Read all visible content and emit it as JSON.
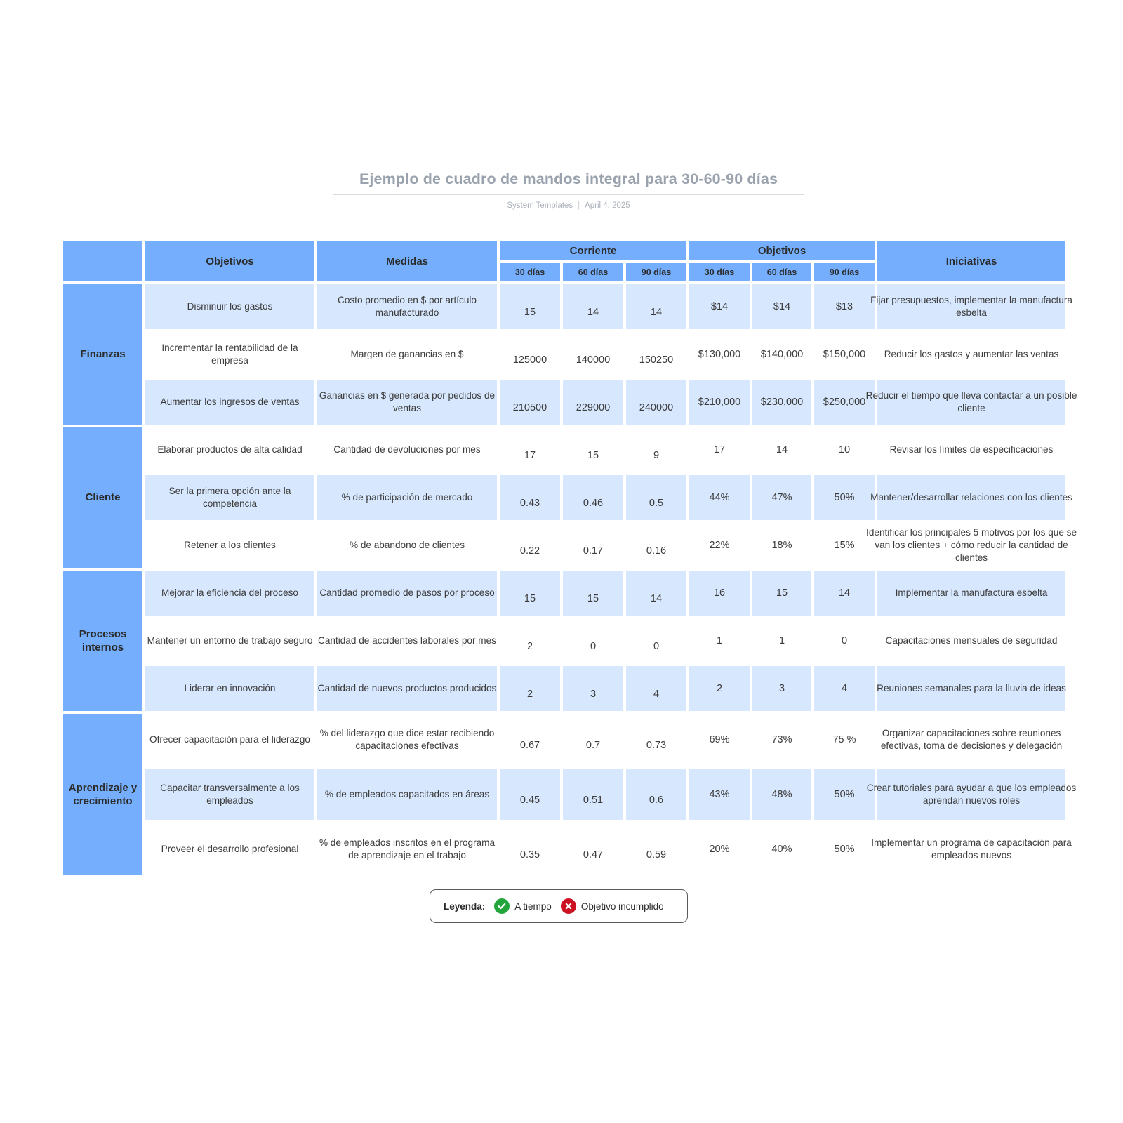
{
  "header": {
    "title": "Ejemplo de cuadro de mandos integral para 30-60-90 días",
    "author": "System Templates",
    "separator": "|",
    "date": "April 4, 2025"
  },
  "colors": {
    "header_blue": "#74aefc",
    "cell_blue": "#d7e7fd",
    "ontime_green": "#22a63c",
    "missed_red": "#cc1122"
  },
  "table": {
    "columns": {
      "perspective": "",
      "objectives": "Objetivos",
      "measures": "Medidas",
      "current_group": "Corriente",
      "targets_group": "Objetivos",
      "initiatives": "Iniciativas",
      "periods": [
        "30 días",
        "60 días",
        "90 días"
      ]
    },
    "sections": [
      {
        "name": "Finanzas",
        "rows": [
          {
            "objective": "Disminuir los gastos",
            "measure": "Costo promedio en $ por artículo manufacturado",
            "current": [
              "15",
              "14",
              "14"
            ],
            "target": [
              "$14",
              "$14",
              "$13"
            ],
            "initiative": "Fijar presupuestos, implementar la manufactura esbelta",
            "tint": true
          },
          {
            "objective": "Incrementar la rentabilidad de la empresa",
            "measure": "Margen de ganancias en $",
            "current": [
              "125000",
              "140000",
              "150250"
            ],
            "target": [
              "$130,000",
              "$140,000",
              "$150,000"
            ],
            "initiative": "Reducir los gastos y aumentar las ventas",
            "tint": false
          },
          {
            "objective": "Aumentar los ingresos de ventas",
            "measure": "Ganancias en $ generada por pedidos de ventas",
            "current": [
              "210500",
              "229000",
              "240000"
            ],
            "target": [
              "$210,000",
              "$230,000",
              "$250,000"
            ],
            "initiative": "Reducir el tiempo que lleva contactar a un posible cliente",
            "tint": true
          }
        ]
      },
      {
        "name": "Cliente",
        "rows": [
          {
            "objective": "Elaborar productos de alta calidad",
            "measure": "Cantidad de devoluciones por mes",
            "current": [
              "17",
              "15",
              "9"
            ],
            "target": [
              "17",
              "14",
              "10"
            ],
            "initiative": "Revisar los límites de especificaciones",
            "tint": false
          },
          {
            "objective": "Ser la primera opción ante la competencia",
            "measure": "% de participación de mercado",
            "current": [
              "0.43",
              "0.46",
              "0.5"
            ],
            "target": [
              "44%",
              "47%",
              "50%"
            ],
            "initiative": "Mantener/desarrollar relaciones con los clientes",
            "tint": true
          },
          {
            "objective": "Retener a los clientes",
            "measure": "% de abandono de clientes",
            "current": [
              "0.22",
              "0.17",
              "0.16"
            ],
            "target": [
              "22%",
              "18%",
              "15%"
            ],
            "initiative": "Identificar los principales 5 motivos por los que se van los clientes + cómo reducir la cantidad de clientes",
            "tint": false
          }
        ]
      },
      {
        "name": "Procesos internos",
        "rows": [
          {
            "objective": "Mejorar la eficiencia del proceso",
            "measure": "Cantidad promedio de pasos por proceso",
            "current": [
              "15",
              "15",
              "14"
            ],
            "target": [
              "16",
              "15",
              "14"
            ],
            "initiative": "Implementar la manufactura esbelta",
            "tint": true
          },
          {
            "objective": "Mantener un entorno de trabajo seguro",
            "measure": "Cantidad de accidentes laborales por mes",
            "current": [
              "2",
              "0",
              "0"
            ],
            "target": [
              "1",
              "1",
              "0"
            ],
            "initiative": "Capacitaciones mensuales de seguridad",
            "tint": false
          },
          {
            "objective": "Liderar en innovación",
            "measure": "Cantidad de nuevos productos producidos",
            "current": [
              "2",
              "3",
              "4"
            ],
            "target": [
              "2",
              "3",
              "4"
            ],
            "initiative": "Reuniones semanales para la lluvia de ideas",
            "tint": true
          }
        ]
      },
      {
        "name": "Aprendizaje y crecimiento",
        "rows": [
          {
            "objective": "Ofrecer capacitación para el liderazgo",
            "measure": "% del liderazgo que dice estar recibiendo capacitaciones efectivas",
            "current": [
              "0.67",
              "0.7",
              "0.73"
            ],
            "target": [
              "69%",
              "73%",
              "75 %"
            ],
            "initiative": "Organizar capacitaciones sobre reuniones efectivas, toma de decisiones y delegación",
            "tint": false
          },
          {
            "objective": "Capacitar transversalmente a los empleados",
            "measure": "% de empleados capacitados en áreas",
            "current": [
              "0.45",
              "0.51",
              "0.6"
            ],
            "target": [
              "43%",
              "48%",
              "50%"
            ],
            "initiative": "Crear tutoriales para ayudar a que los empleados aprendan nuevos roles",
            "tint": true
          },
          {
            "objective": "Proveer el desarrollo profesional",
            "measure": "% de empleados inscritos en el programa de aprendizaje en el trabajo",
            "current": [
              "0.35",
              "0.47",
              "0.59"
            ],
            "target": [
              "20%",
              "40%",
              "50%"
            ],
            "initiative": "Implementar un programa de capacitación para empleados nuevos",
            "tint": false
          }
        ]
      }
    ]
  },
  "legend": {
    "label": "Leyenda:",
    "items": [
      {
        "icon": "check-circle-icon",
        "text": "A tiempo"
      },
      {
        "icon": "x-circle-icon",
        "text": "Objetivo incumplido"
      }
    ]
  }
}
